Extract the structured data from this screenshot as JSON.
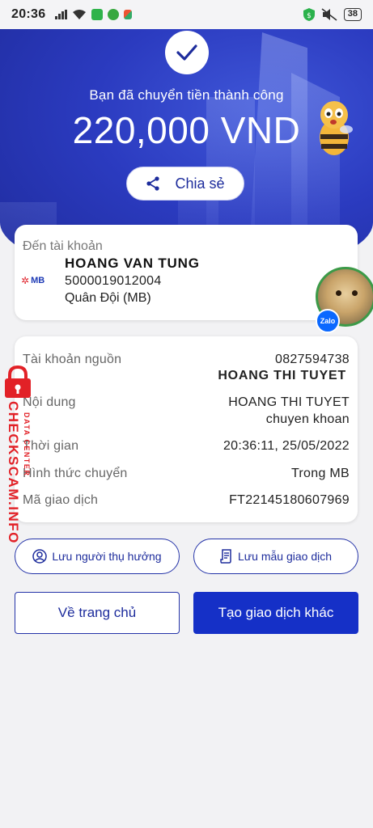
{
  "status_bar": {
    "time": "20:36",
    "battery": "38"
  },
  "hero": {
    "message": "Bạn đã chuyển tiền thành công",
    "amount": "220,000 VND",
    "share_label": "Chia sẻ"
  },
  "destination": {
    "label": "Đến tài khoản",
    "bank_logo": "MB",
    "name": "HOANG VAN TUNG",
    "account": "5000019012004",
    "bank": "Quân Đội (MB)",
    "badge": "Zalo"
  },
  "details": {
    "source_label": "Tài khoản nguồn",
    "source_account": "0827594738",
    "source_name": "HOANG THI TUYET",
    "content_label": "Nội dung",
    "content_line1": "HOANG THI TUYET",
    "content_line2": "chuyen khoan",
    "time_label": "Thời gian",
    "time_value": "20:36:11, 25/05/2022",
    "method_label": "Hình thức chuyển",
    "method_value": "Trong MB",
    "code_label": "Mã giao dịch",
    "code_value": "FT22145180607969"
  },
  "actions": {
    "save_beneficiary": "Lưu người thụ hưởng",
    "save_template": "Lưu mẫu giao dịch",
    "home": "Về trang chủ",
    "new_transaction": "Tạo giao dịch khác"
  },
  "watermark": {
    "main": "CHECKSCAM.INFO",
    "sub": "DATA CENTER"
  },
  "colors": {
    "primary": "#1530c7",
    "hero": "#2b3bc0",
    "watermark": "#e22127"
  }
}
